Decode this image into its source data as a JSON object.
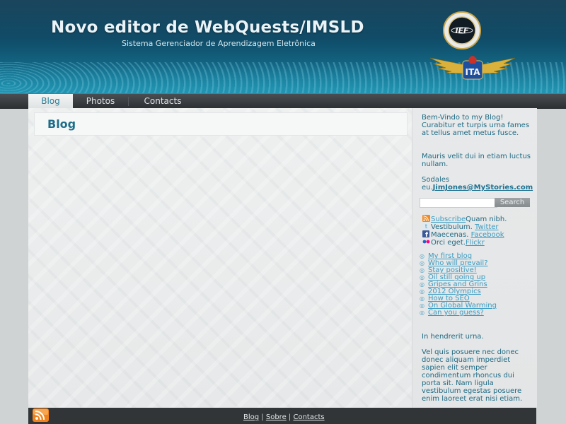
{
  "header": {
    "title": "Novo editor de WebQuests/IMSLD",
    "subtitle": "Sistema Gerenciador de Aprendizagem Eletrônica",
    "logo_ief_text": "IEF",
    "logo_ita_text": "ITA"
  },
  "nav": {
    "tabs": [
      {
        "label": "Blog",
        "active": true
      },
      {
        "label": "Photos",
        "active": false
      },
      {
        "label": "Contacts",
        "active": false
      }
    ]
  },
  "main": {
    "heading": "Blog"
  },
  "sidebar": {
    "welcome": "Bem-Vindo to my Blog! Curabitur et turpis urna fames at tellus amet metus fusce.",
    "paragraph2": "Mauris velit dui in etiam luctus nullam.",
    "sodales_prefix": "Sodales eu.",
    "email": "JimJones@MyStories.com",
    "search": {
      "placeholder": "",
      "button_label": "Search"
    },
    "social": [
      {
        "icon": "rss-icon",
        "link": "Subscribe",
        "text": "Quam nibh.",
        "link_first": true
      },
      {
        "icon": "twitter-icon",
        "link": "Twitter",
        "text": "Vestibulum. ",
        "link_first": false
      },
      {
        "icon": "facebook-icon",
        "link": "Facebook",
        "text": "Maecenas. ",
        "link_first": false
      },
      {
        "icon": "flickr-icon",
        "link": "Flickr",
        "text": "Orci eget.",
        "link_first": false
      }
    ],
    "blog_posts": [
      "My first blog",
      "Who will prevail?",
      "Stay positive!",
      "Oil still going up",
      "Gripes and Grins",
      "2012 Olympics",
      "How to SEO",
      "On Global Warming",
      "Can you guess?"
    ],
    "hendrerit": "In hendrerit urna.",
    "paragraph_last": "Vel quis posuere nec donec donec aliquam imperdiet sapien elit semper condimentum rhoncus dui porta sit. Nam ligula vestibulum egestas posuere enim laoreet erat nisi etiam."
  },
  "footer": {
    "links": [
      "Blog",
      "Sobre",
      "Contacts"
    ],
    "separator": "|"
  },
  "colors": {
    "header_dark": "#0c3a52",
    "header_light": "#1a88a5",
    "accent": "#1e6e8a",
    "link": "#3a9cc2"
  }
}
